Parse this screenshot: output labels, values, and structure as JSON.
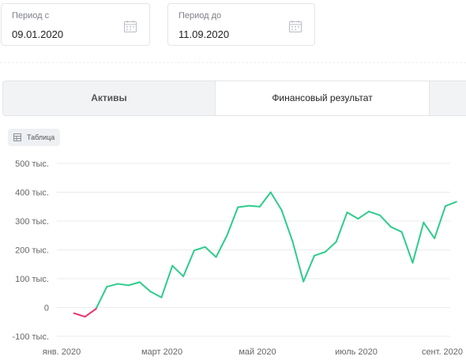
{
  "filters": {
    "from": {
      "label": "Период с",
      "value": "09.01.2020",
      "icon": "calendar-icon"
    },
    "to": {
      "label": "Период до",
      "value": "11.09.2020",
      "icon": "calendar-icon"
    }
  },
  "tabs": [
    {
      "label": "Активы",
      "active": false
    },
    {
      "label": "Финансовый результат",
      "active": true
    }
  ],
  "table_button": {
    "label": "Таблица",
    "icon": "table-icon"
  },
  "colors": {
    "positive": "#2ecc8a",
    "negative": "#e8336b",
    "grid": "#e9ebee"
  },
  "chart_data": {
    "type": "line",
    "ylim": [
      -100,
      500
    ],
    "y_ticks": [
      {
        "value": 500,
        "label": "500 тыс."
      },
      {
        "value": 400,
        "label": "400 тыс."
      },
      {
        "value": 300,
        "label": "300 тыс."
      },
      {
        "value": 200,
        "label": "200 тыс."
      },
      {
        "value": 100,
        "label": "100 тыс."
      },
      {
        "value": 0,
        "label": "0"
      },
      {
        "value": -100,
        "label": "-100 тыс."
      }
    ],
    "x_ticks": [
      "янв. 2020",
      "март 2020",
      "май 2020",
      "июль 2020",
      "сент. 2020"
    ],
    "x": [
      "2020-01-09",
      "2020-01-16",
      "2020-01-23",
      "2020-01-30",
      "2020-02-06",
      "2020-02-13",
      "2020-02-20",
      "2020-02-27",
      "2020-03-05",
      "2020-03-12",
      "2020-03-19",
      "2020-03-26",
      "2020-04-02",
      "2020-04-09",
      "2020-04-16",
      "2020-04-23",
      "2020-04-30",
      "2020-05-07",
      "2020-05-14",
      "2020-05-21",
      "2020-05-28",
      "2020-06-04",
      "2020-06-11",
      "2020-06-18",
      "2020-06-25",
      "2020-07-02",
      "2020-07-09",
      "2020-07-16",
      "2020-07-23",
      "2020-07-30",
      "2020-08-06",
      "2020-08-13",
      "2020-08-20",
      "2020-08-27",
      "2020-09-03",
      "2020-09-10"
    ],
    "values": [
      -20,
      -32,
      -5,
      72,
      82,
      77,
      88,
      55,
      35,
      145,
      108,
      198,
      210,
      175,
      250,
      348,
      353,
      350,
      400,
      338,
      230,
      90,
      180,
      193,
      228,
      330,
      308,
      333,
      320,
      280,
      262,
      155,
      295,
      240,
      352,
      367
    ],
    "grid": true,
    "legend": "none"
  }
}
